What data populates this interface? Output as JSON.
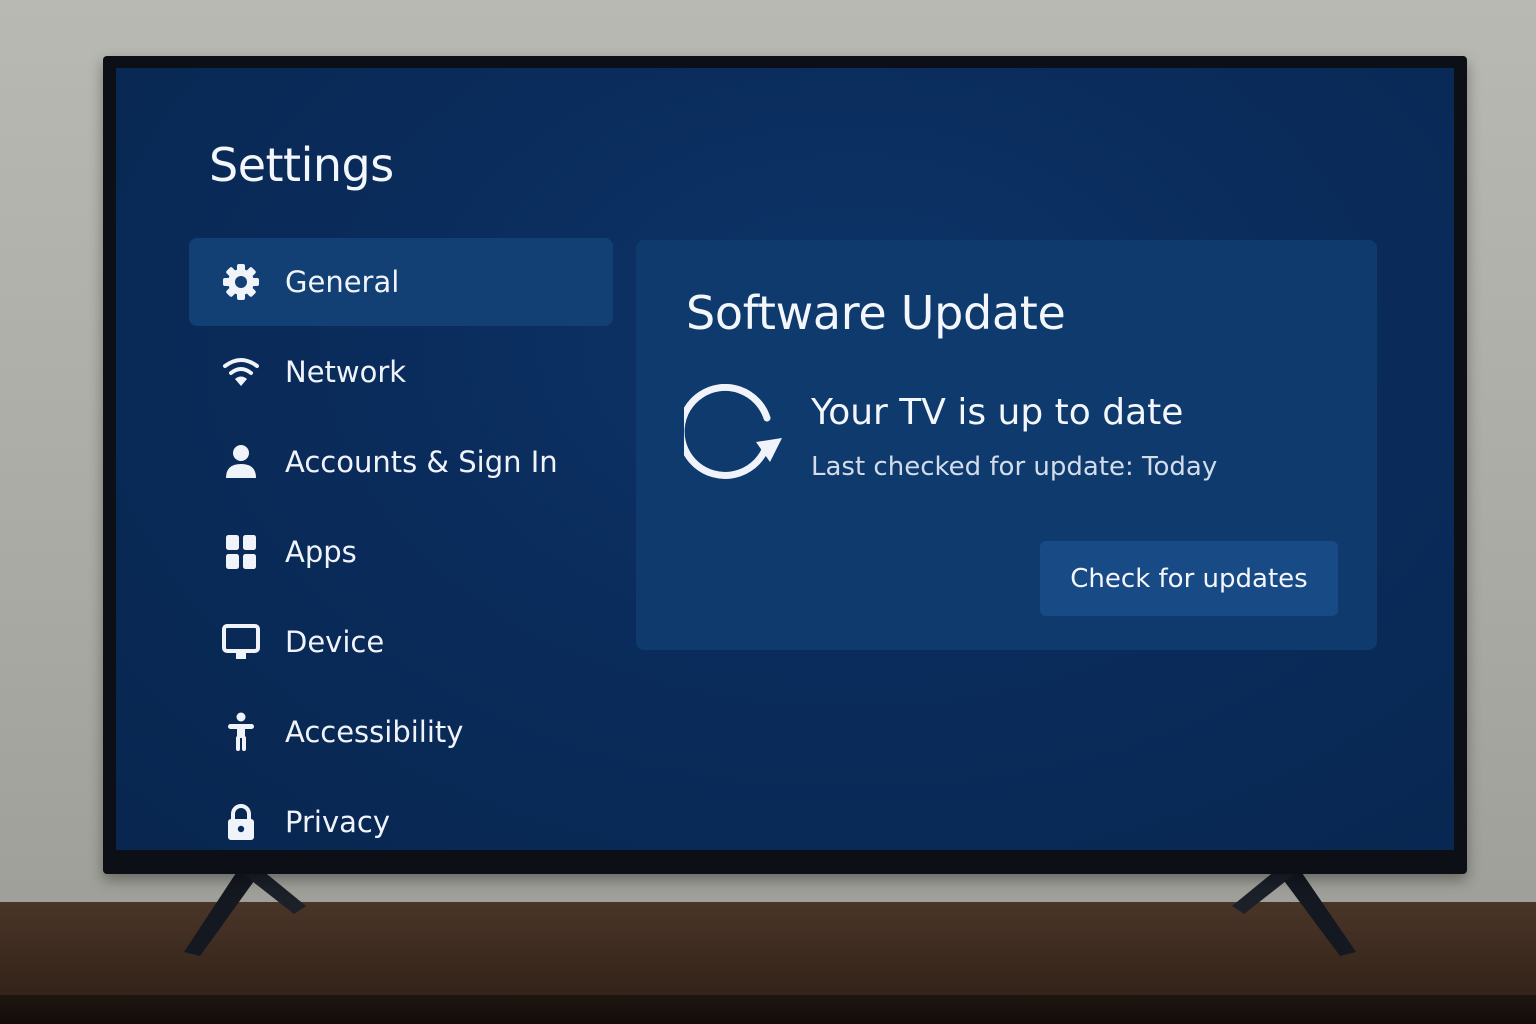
{
  "screen": {
    "title": "Settings"
  },
  "sidebar": {
    "items": [
      {
        "label": "General",
        "icon": "gear-icon",
        "selected": true
      },
      {
        "label": "Network",
        "icon": "wifi-icon",
        "selected": false
      },
      {
        "label": "Accounts & Sign In",
        "icon": "person-icon",
        "selected": false
      },
      {
        "label": "Apps",
        "icon": "apps-grid-icon",
        "selected": false
      },
      {
        "label": "Device",
        "icon": "monitor-icon",
        "selected": false
      },
      {
        "label": "Accessibility",
        "icon": "accessibility-icon",
        "selected": false
      },
      {
        "label": "Privacy",
        "icon": "lock-icon",
        "selected": false
      }
    ]
  },
  "panel": {
    "title": "Software Update",
    "status_icon": "refresh-icon",
    "status_heading": "Your TV is up to date",
    "status_detail": "Last checked for update: Today",
    "button_label": "Check for updates"
  },
  "colors": {
    "screen_background": "#0a2c5c",
    "selected_item": "#123f74",
    "panel_background": "#0f3a6d",
    "button_background": "#184a85",
    "text": "#f3f6fb"
  }
}
